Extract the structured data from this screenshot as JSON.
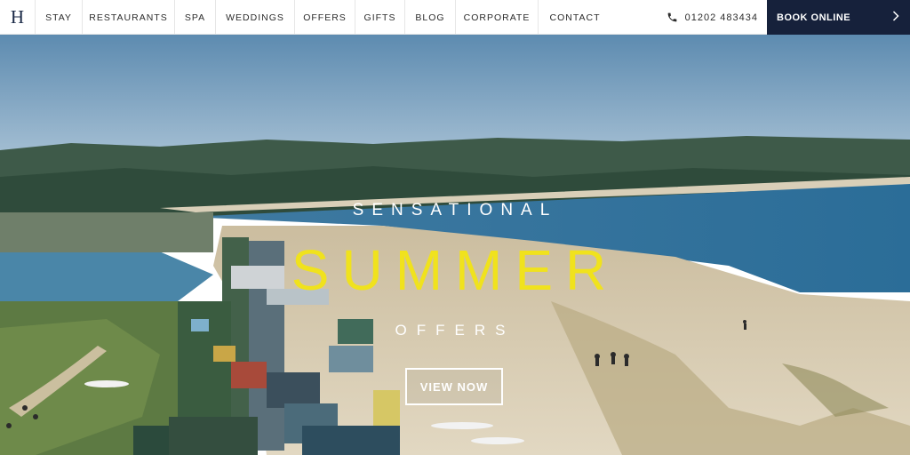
{
  "nav": {
    "logo": "H",
    "items": [
      {
        "label": "STAY"
      },
      {
        "label": "RESTAURANTS"
      },
      {
        "label": "SPA"
      },
      {
        "label": "WEDDINGS"
      },
      {
        "label": "OFFERS"
      },
      {
        "label": "GIFTS"
      },
      {
        "label": "BLOG"
      },
      {
        "label": "CORPORATE"
      },
      {
        "label": "CONTACT"
      }
    ],
    "phone": "01202 483434",
    "phone_icon": "phone-icon",
    "book_label": "BOOK ONLINE",
    "book_icon": "chevron-right-icon"
  },
  "hero": {
    "kicker": "SENSATIONAL",
    "headline": "SUMMER",
    "subheading": "OFFERS",
    "cta_label": "VIEW NOW",
    "colors": {
      "headline": "#f0e21d",
      "accent_navy": "#16213b"
    }
  }
}
